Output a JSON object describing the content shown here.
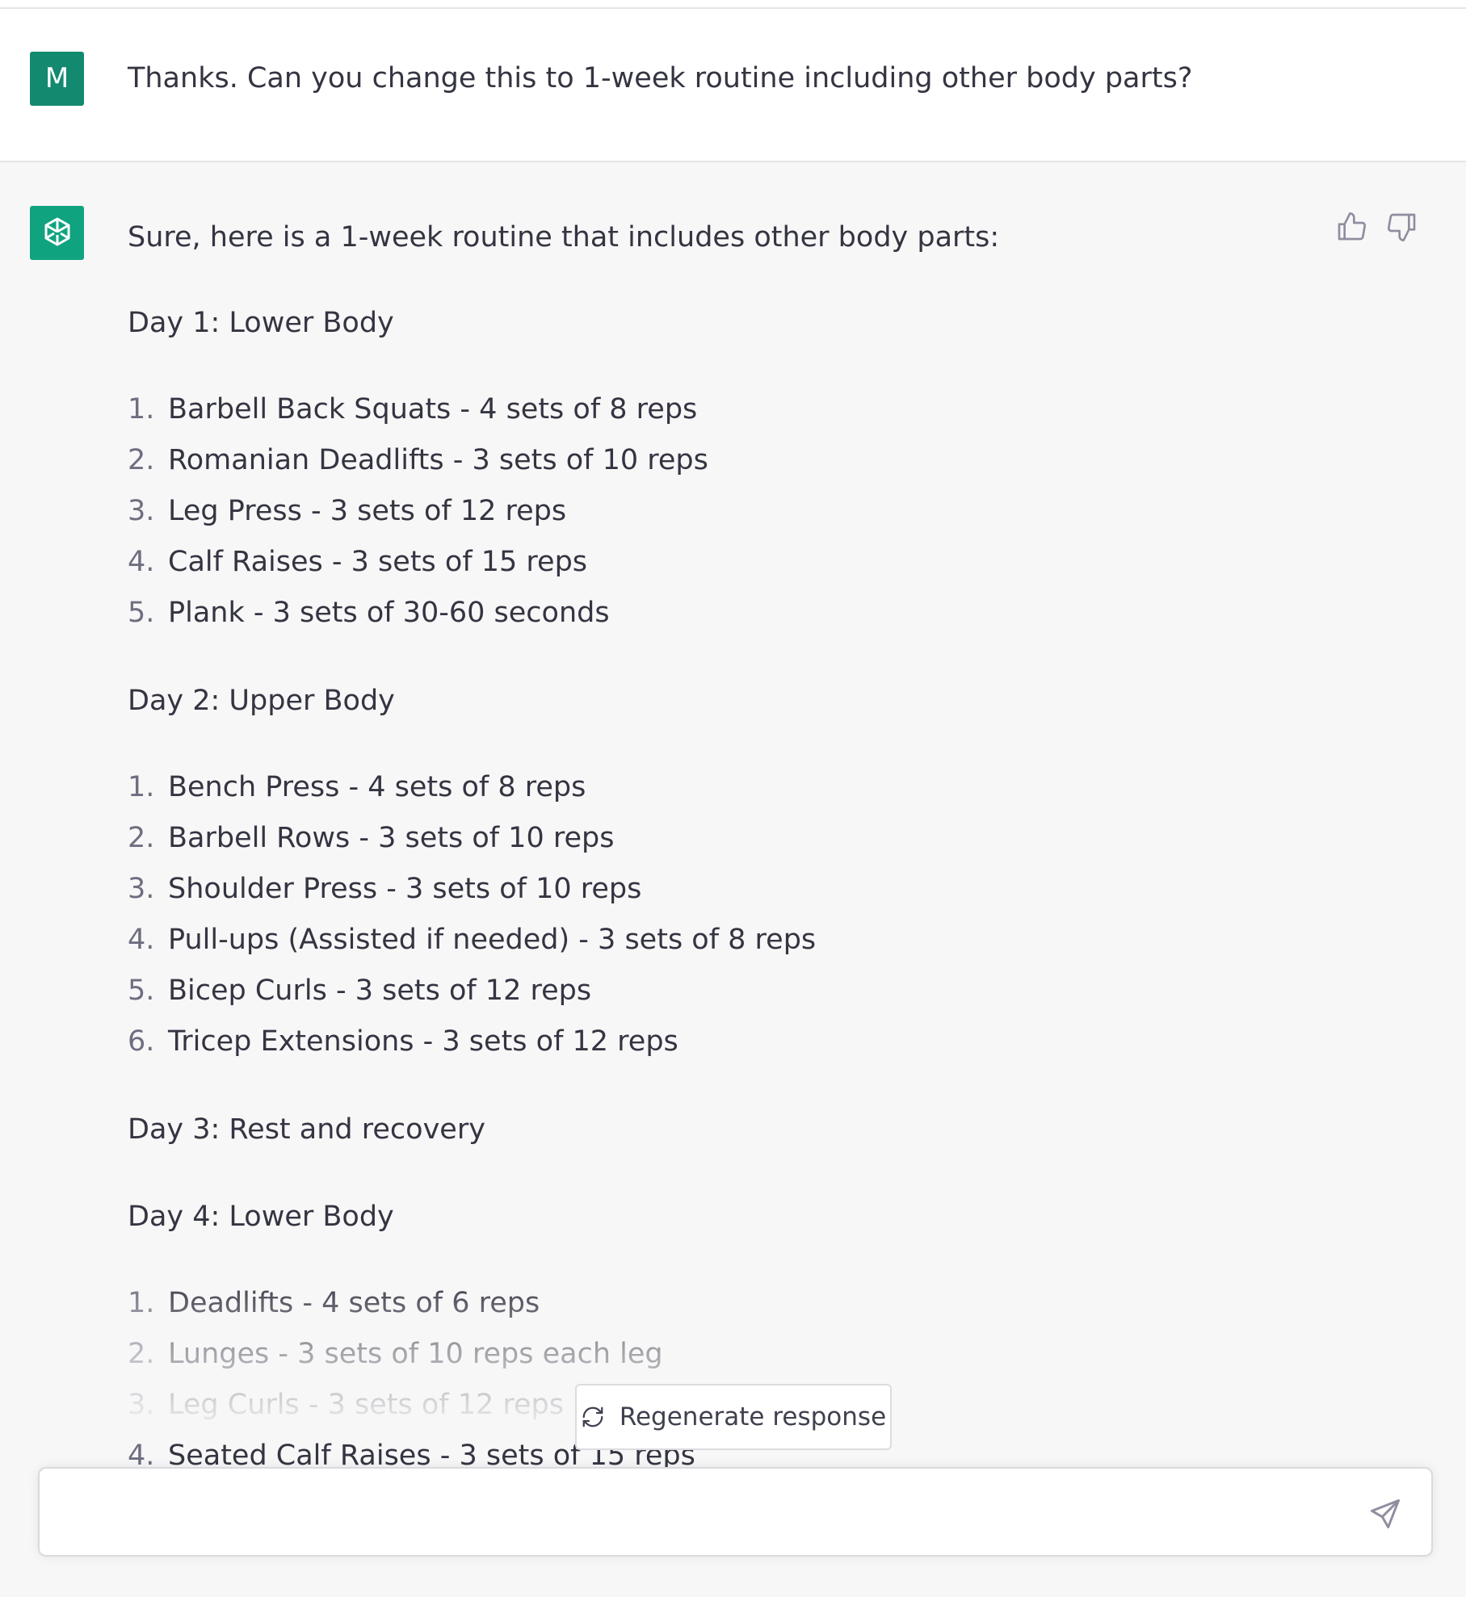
{
  "user_message": {
    "avatar_initial": "M",
    "text": "Thanks. Can you change this to 1-week routine including other body parts?"
  },
  "assistant_message": {
    "intro": "Sure, here is a 1-week routine that includes other body parts:",
    "days": [
      {
        "title": "Day 1: Lower Body",
        "items": [
          {
            "num": "1.",
            "text": "Barbell Back Squats - 4 sets of 8 reps"
          },
          {
            "num": "2.",
            "text": "Romanian Deadlifts - 3 sets of 10 reps"
          },
          {
            "num": "3.",
            "text": "Leg Press - 3 sets of 12 reps"
          },
          {
            "num": "4.",
            "text": "Calf Raises - 3 sets of 15 reps"
          },
          {
            "num": "5.",
            "text": "Plank - 3 sets of 30-60 seconds"
          }
        ]
      },
      {
        "title": "Day 2: Upper Body",
        "items": [
          {
            "num": "1.",
            "text": "Bench Press - 4 sets of 8 reps"
          },
          {
            "num": "2.",
            "text": "Barbell Rows - 3 sets of 10 reps"
          },
          {
            "num": "3.",
            "text": "Shoulder Press - 3 sets of 10 reps"
          },
          {
            "num": "4.",
            "text": "Pull-ups (Assisted if needed) - 3 sets of 8 reps"
          },
          {
            "num": "5.",
            "text": "Bicep Curls - 3 sets of 12 reps"
          },
          {
            "num": "6.",
            "text": "Tricep Extensions - 3 sets of 12 reps"
          }
        ]
      },
      {
        "title": "Day 3: Rest and recovery",
        "items": []
      },
      {
        "title": "Day 4: Lower Body",
        "items": [
          {
            "num": "1.",
            "text": "Deadlifts - 4 sets of 6 reps"
          },
          {
            "num": "2.",
            "text": "Lunges - 3 sets of 10 reps each leg"
          },
          {
            "num": "3.",
            "text": "Leg Curls - 3 sets of 12 reps"
          },
          {
            "num": "4.",
            "text": "Seated Calf Raises - 3 sets of 15 reps"
          }
        ]
      }
    ]
  },
  "feedback": {
    "thumbs_up_icon": "thumbs-up-icon",
    "thumbs_down_icon": "thumbs-down-icon"
  },
  "regenerate": {
    "label": "Regenerate response",
    "icon": "refresh-icon"
  },
  "composer": {
    "value": "",
    "send_icon": "paper-plane-icon"
  },
  "colors": {
    "avatar_user_bg": "#13896f",
    "avatar_bot_bg": "#10a37f",
    "assistant_bg": "#f7f7f8",
    "text": "#343541"
  }
}
